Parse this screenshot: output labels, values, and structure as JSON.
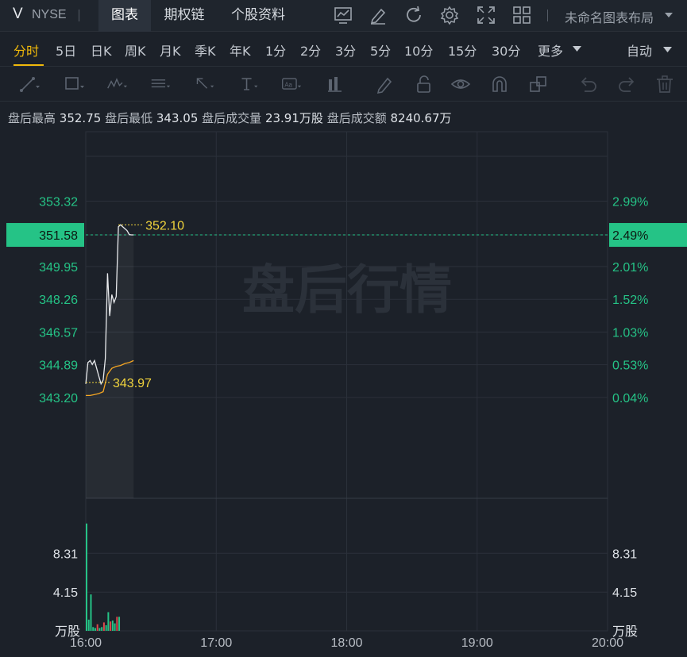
{
  "header": {
    "ticker": "V",
    "exchange": "NYSE",
    "tabs": [
      {
        "label": "图表",
        "active": true
      },
      {
        "label": "期权链",
        "active": false
      },
      {
        "label": "个股资料",
        "active": false
      }
    ],
    "icons": [
      "indicator-icon",
      "draw-icon",
      "refresh-icon",
      "settings-icon",
      "fullscreen-icon",
      "grid-layout-icon"
    ],
    "layout_name": "未命名图表布局"
  },
  "periods": {
    "items": [
      "分时",
      "5日",
      "日K",
      "周K",
      "月K",
      "季K",
      "年K",
      "1分",
      "2分",
      "3分",
      "5分",
      "10分",
      "15分",
      "30分",
      "更多"
    ],
    "active": "分时",
    "right_label": "自动"
  },
  "draw_tools": [
    "trendline-icon",
    "rectangle-icon",
    "wave-icon",
    "fib-icon",
    "arrow-icon",
    "text-tool-icon",
    "label-icon",
    "measure-icon",
    "pen-icon",
    "lock-icon",
    "eye-icon",
    "magnet-icon",
    "layers-icon",
    "undo-icon",
    "redo-icon",
    "trash-icon"
  ],
  "info": {
    "high_label": "盘后最高",
    "high_value": "352.75",
    "low_label": "盘后最低",
    "low_value": "343.05",
    "volume_label": "盘后成交量",
    "volume_value": "23.91万股",
    "amount_label": "盘后成交额",
    "amount_value": "8240.67万"
  },
  "colors": {
    "up": "#25c386",
    "price_line": "#e8eaed",
    "avg_line": "#f5a623",
    "annotation": "#f0d33c",
    "grid": "#2b313a",
    "bg": "#1c2129"
  },
  "chart_data": {
    "type": "line",
    "watermark": "盘后行情",
    "price_axis": {
      "ticks": [
        353.32,
        351.58,
        349.95,
        348.26,
        346.57,
        344.89,
        343.2
      ],
      "labels": [
        "353.32",
        "351.58",
        "349.95",
        "348.26",
        "346.57",
        "344.89",
        "343.20"
      ],
      "range": [
        338.0,
        356.9
      ],
      "current_price": "351.58",
      "current_pct": "2.49%"
    },
    "pct_axis": {
      "labels": [
        "2.99%",
        "2.49%",
        "2.01%",
        "1.52%",
        "1.03%",
        "0.53%",
        "0.04%"
      ]
    },
    "time_axis": {
      "labels": [
        "16:00",
        "17:00",
        "18:00",
        "19:00",
        "20:00"
      ],
      "range_minutes": [
        0,
        240
      ]
    },
    "price_series": {
      "name": "price",
      "x": [
        0,
        1,
        2,
        3,
        4,
        5,
        6,
        7,
        8,
        9,
        10,
        11,
        12,
        13,
        14,
        15,
        16,
        17,
        18,
        19,
        20,
        21,
        22
      ],
      "y": [
        343.9,
        345.0,
        345.1,
        344.9,
        345.1,
        344.7,
        344.3,
        343.9,
        344.1,
        345.2,
        349.6,
        347.4,
        348.5,
        348.1,
        348.4,
        352.0,
        352.1,
        352.0,
        351.9,
        351.8,
        351.6,
        351.58,
        351.58
      ]
    },
    "avg_series": {
      "name": "avg",
      "x": [
        0,
        2,
        4,
        6,
        8,
        10,
        12,
        14,
        16,
        18,
        20,
        22
      ],
      "y": [
        343.3,
        343.3,
        343.35,
        343.4,
        343.5,
        344.4,
        344.7,
        344.8,
        344.85,
        344.95,
        345.0,
        345.1
      ]
    },
    "annotations": [
      {
        "label": "352.10",
        "x": 15,
        "y": 352.1
      },
      {
        "label": "343.97",
        "x": 0,
        "y": 343.97
      }
    ],
    "volume": {
      "axis_labels": [
        "8.31",
        "4.15"
      ],
      "axis_ticks": [
        8.31,
        4.15
      ],
      "unit": "万股",
      "max": 12.5,
      "x": [
        0,
        1,
        2,
        3,
        4,
        5,
        6,
        7,
        8,
        9,
        10,
        11,
        12,
        13,
        14,
        15
      ],
      "values": [
        11.5,
        1.2,
        3.9,
        0.4,
        0.3,
        0.7,
        0.3,
        0.4,
        0.9,
        0.6,
        2.0,
        1.0,
        1.1,
        0.8,
        1.5,
        1.5
      ],
      "colors": [
        "up",
        "up",
        "up",
        "up",
        "up",
        "down",
        "up",
        "up",
        "down",
        "up",
        "up",
        "down",
        "up",
        "up",
        "down",
        "up"
      ]
    }
  }
}
